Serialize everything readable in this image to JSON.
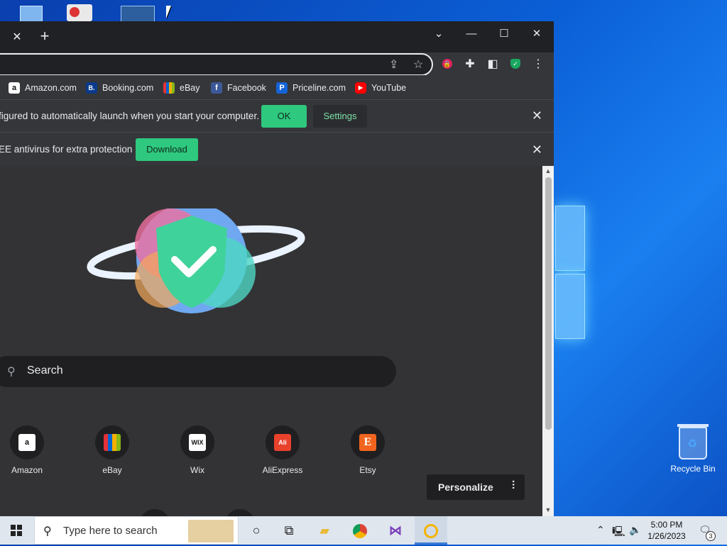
{
  "browser": {
    "tab_close": "✕",
    "tab_new": "+",
    "window_controls": {
      "dropdown": "⌄",
      "minimize": "—",
      "maximize": "☐",
      "close": "✕"
    },
    "toolbar_icons": [
      "share-icon",
      "star-icon",
      "extension-red-icon",
      "puzzle-icon",
      "sidepanel-icon",
      "shield-icon",
      "menu-icon"
    ],
    "bookmarks": [
      {
        "label": "Amazon.com",
        "icon": "a",
        "bg": "#ffffff",
        "fg": "#111111"
      },
      {
        "label": "Booking.com",
        "icon": "B.",
        "bg": "#0a3a8c",
        "fg": "#ffffff"
      },
      {
        "label": "eBay",
        "icon": "e",
        "bg": "#e53238",
        "fg": "#ffffff"
      },
      {
        "label": "Facebook",
        "icon": "f",
        "bg": "#3b5998",
        "fg": "#ffffff"
      },
      {
        "label": "Priceline.com",
        "icon": "P",
        "bg": "#1463d6",
        "fg": "#ffffff"
      },
      {
        "label": "YouTube",
        "icon": "▶",
        "bg": "#ff0000",
        "fg": "#ffffff"
      }
    ],
    "infobar1": {
      "message": "figured to automatically launch when you start your computer.",
      "ok": "OK",
      "settings": "Settings",
      "close": "✕"
    },
    "infobar2": {
      "message": "EE antivirus for extra protection",
      "download": "Download",
      "close": "✕"
    },
    "newtab": {
      "search_placeholder": "Search",
      "shortcuts": [
        {
          "label": "Amazon",
          "icon": "a",
          "bg": "#ffffff",
          "fg": "#111111"
        },
        {
          "label": "eBay",
          "icon": "🛍",
          "bg": "transparent",
          "fg": "#ffcc00"
        },
        {
          "label": "Wix",
          "icon": "WIX",
          "bg": "#ffffff",
          "fg": "#111111"
        },
        {
          "label": "AliExpress",
          "icon": "Ali",
          "bg": "#e8412c",
          "fg": "#ffffff"
        },
        {
          "label": "Etsy",
          "icon": "E",
          "bg": "#f1641e",
          "fg": "#ffffff"
        }
      ],
      "personalize": "Personalize"
    }
  },
  "desktop": {
    "recycle_bin": "Recycle Bin"
  },
  "taskbar": {
    "search_placeholder": "Type here to search",
    "time": "5:00 PM",
    "date": "1/26/2023",
    "notification_count": "3"
  }
}
